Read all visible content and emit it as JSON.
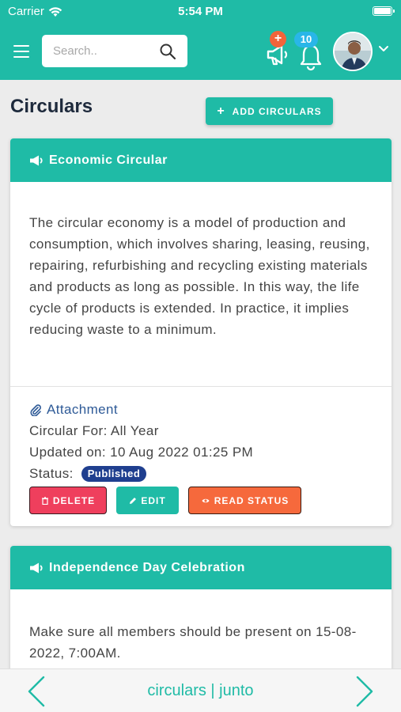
{
  "status_bar": {
    "carrier": "Carrier",
    "time": "5:54 PM"
  },
  "header": {
    "search_placeholder": "Search..",
    "announcement_badge": "+",
    "notification_count": "10"
  },
  "page": {
    "title": "Circulars",
    "add_button_label": "ADD CIRCULARS"
  },
  "circulars": [
    {
      "title": "Economic Circular",
      "body": "The circular economy is a model of production and consumption, which involves sharing, leasing, reusing, repairing, refurbishing and recycling existing materials and products as long as possible. In this way, the life cycle of products is extended. In practice, it implies reducing waste to a minimum.",
      "attachment_label": "Attachment",
      "circular_for": "Circular For: All Year",
      "updated_on": "Updated on: 10 Aug 2022 01:25 PM",
      "status_label": "Status:",
      "status_value": "Published",
      "delete_label": "DELETE",
      "edit_label": "EDIT",
      "read_status_label": "READ STATUS"
    },
    {
      "title": "Independence Day Celebration",
      "body": "Make sure all members should be present on 15-08-2022, 7:00AM."
    }
  ],
  "bottom_bar": {
    "title": "circulars | junto"
  },
  "colors": {
    "primary": "#1fbba6",
    "delete": "#ef3f5d",
    "read_status": "#f6693c",
    "published": "#1f3f8f",
    "title": "#1e2a3c"
  },
  "icons": [
    "wifi-icon",
    "battery-icon",
    "menu-icon",
    "search-icon",
    "megaphone-icon",
    "bell-icon",
    "avatar",
    "chevron-down-icon",
    "paperclip-icon",
    "trash-icon",
    "pencil-icon",
    "eye-icon",
    "chevron-left-icon",
    "chevron-right-icon"
  ]
}
